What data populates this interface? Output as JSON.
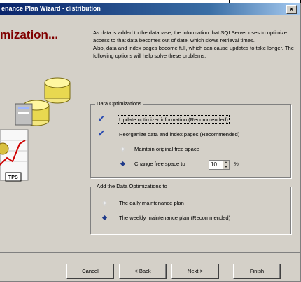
{
  "window": {
    "title": "enance Plan Wizard - distribution",
    "close_label": "×"
  },
  "page": {
    "heading": "mization...",
    "intro_p1": "As data is added to the database, the information that SQLServer uses to optimize access to that data becomes out of date, which slows retrieval times.",
    "intro_p2": "Also, data and index pages become full, which can cause updates to take longer. The following options will help solve these problems:"
  },
  "data_optimizations": {
    "legend": "Data Optimizations",
    "update_optimizer": {
      "label": "Update optimizer information (Recommended)",
      "checked": true
    },
    "reorganize": {
      "label": "Reorganize data and index pages (Recommended)",
      "checked": true
    },
    "maintain_free_space": {
      "label": "Maintain original free space",
      "selected": false
    },
    "change_free_space": {
      "label": "Change free space to",
      "selected": true,
      "value": "10",
      "unit": "%"
    }
  },
  "add_to": {
    "legend": "Add the Data Optimizations to",
    "daily": {
      "label": "The daily maintenance plan",
      "selected": false
    },
    "weekly": {
      "label": "The weekly maintenance plan (Recommended)",
      "selected": true
    }
  },
  "buttons": {
    "cancel": "Cancel",
    "back": "< Back",
    "next": "Next >",
    "finish": "Finish"
  },
  "art": {
    "label": "TPS"
  },
  "colors": {
    "title_start": "#0a246a",
    "heading": "#800000",
    "dialog_bg": "#d4d0c8"
  }
}
